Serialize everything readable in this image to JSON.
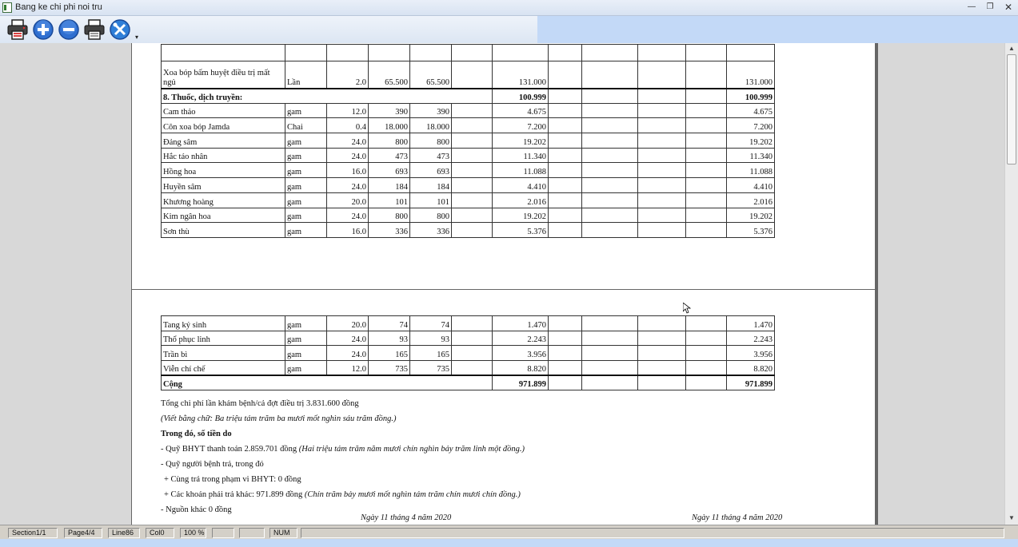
{
  "window": {
    "title": "Bang ke chi phi noi tru"
  },
  "toolbar": {
    "buttons": [
      {
        "name": "print-preview",
        "icon": "print-preview-icon"
      },
      {
        "name": "zoom-in",
        "icon": "plus-circle-icon"
      },
      {
        "name": "zoom-out",
        "icon": "minus-circle-icon"
      },
      {
        "name": "print",
        "icon": "printer-icon"
      },
      {
        "name": "tools",
        "icon": "tools-icon"
      }
    ]
  },
  "page1": {
    "rows": [
      {
        "name": "Xoa bóp bấm huyệt điều trị mất ngủ",
        "unit": "Lần",
        "qty": "2.0",
        "price1": "65.500",
        "price2": "65.500",
        "c6": "",
        "amount": "131.000",
        "c8": "",
        "c9": "",
        "c10": "",
        "c11": "",
        "total": "131.000"
      },
      {
        "name": "8. Thuốc, dịch truyền:",
        "amount": "100.999",
        "total": "100.999"
      },
      {
        "name": "Cam thảo",
        "unit": "gam",
        "qty": "12.0",
        "price1": "390",
        "price2": "390",
        "c6": "",
        "amount": "4.675",
        "c8": "",
        "c9": "",
        "c10": "",
        "c11": "",
        "total": "4.675"
      },
      {
        "name": "Côn xoa bóp Jamda",
        "unit": "Chai",
        "qty": "0.4",
        "price1": "18.000",
        "price2": "18.000",
        "c6": "",
        "amount": "7.200",
        "c8": "",
        "c9": "",
        "c10": "",
        "c11": "",
        "total": "7.200"
      },
      {
        "name": "Đảng sâm",
        "unit": "gam",
        "qty": "24.0",
        "price1": "800",
        "price2": "800",
        "c6": "",
        "amount": "19.202",
        "c8": "",
        "c9": "",
        "c10": "",
        "c11": "",
        "total": "19.202"
      },
      {
        "name": "Hắc táo nhân",
        "unit": "gam",
        "qty": "24.0",
        "price1": "473",
        "price2": "473",
        "c6": "",
        "amount": "11.340",
        "c8": "",
        "c9": "",
        "c10": "",
        "c11": "",
        "total": "11.340"
      },
      {
        "name": "Hồng hoa",
        "unit": "gam",
        "qty": "16.0",
        "price1": "693",
        "price2": "693",
        "c6": "",
        "amount": "11.088",
        "c8": "",
        "c9": "",
        "c10": "",
        "c11": "",
        "total": "11.088"
      },
      {
        "name": "Huyền sâm",
        "unit": "gam",
        "qty": "24.0",
        "price1": "184",
        "price2": "184",
        "c6": "",
        "amount": "4.410",
        "c8": "",
        "c9": "",
        "c10": "",
        "c11": "",
        "total": "4.410"
      },
      {
        "name": "Khương hoàng",
        "unit": "gam",
        "qty": "20.0",
        "price1": "101",
        "price2": "101",
        "c6": "",
        "amount": "2.016",
        "c8": "",
        "c9": "",
        "c10": "",
        "c11": "",
        "total": "2.016"
      },
      {
        "name": "Kim ngân hoa",
        "unit": "gam",
        "qty": "24.0",
        "price1": "800",
        "price2": "800",
        "c6": "",
        "amount": "19.202",
        "c8": "",
        "c9": "",
        "c10": "",
        "c11": "",
        "total": "19.202"
      },
      {
        "name": "Sơn thù",
        "unit": "gam",
        "qty": "16.0",
        "price1": "336",
        "price2": "336",
        "c6": "",
        "amount": "5.376",
        "c8": "",
        "c9": "",
        "c10": "",
        "c11": "",
        "total": "5.376"
      }
    ]
  },
  "page2": {
    "rows": [
      {
        "name": "Tang ký sinh",
        "unit": "gam",
        "qty": "20.0",
        "price1": "74",
        "price2": "74",
        "c6": "",
        "amount": "1.470",
        "c8": "",
        "c9": "",
        "c10": "",
        "c11": "",
        "total": "1.470"
      },
      {
        "name": "Thổ phục linh",
        "unit": "gam",
        "qty": "24.0",
        "price1": "93",
        "price2": "93",
        "c6": "",
        "amount": "2.243",
        "c8": "",
        "c9": "",
        "c10": "",
        "c11": "",
        "total": "2.243"
      },
      {
        "name": "Trần bì",
        "unit": "gam",
        "qty": "24.0",
        "price1": "165",
        "price2": "165",
        "c6": "",
        "amount": "3.956",
        "c8": "",
        "c9": "",
        "c10": "",
        "c11": "",
        "total": "3.956"
      },
      {
        "name": "Viễn chí chế",
        "unit": "gam",
        "qty": "12.0",
        "price1": "735",
        "price2": "735",
        "c6": "",
        "amount": "8.820",
        "c8": "",
        "c9": "",
        "c10": "",
        "c11": "",
        "total": "8.820"
      }
    ],
    "total_row": {
      "label": "Cộng",
      "amount": "971.899",
      "total": "971.899"
    },
    "notes": {
      "line1": "Tổng chi phí lần khám bệnh/cả đợt điều trị 3.831.600 đồng",
      "line2": "(Viết bằng chữ: Ba triệu tám trăm ba mươi mốt nghìn sáu trăm đồng.)",
      "line3": "Trong đó, số tiền do",
      "line4_a": "- Quỹ BHYT thanh toán 2.859.701 đồng ",
      "line4_b": "(Hai triệu tám trăm năm mươi chín nghìn bảy trăm linh một đồng.)",
      "line5": "- Quỹ người bệnh trả, trong đó",
      "line6": "+ Cùng trả trong phạm vi BHYT: 0 đồng",
      "line7_a": "+ Các khoản phải trả khác: 971.899 đồng ",
      "line7_b": "(Chín trăm bảy mươi mốt nghìn tám trăm chín mươi chín đồng.)",
      "line8": "- Nguồn khác 0 đồng"
    },
    "date_left": "Ngày 11 tháng 4 năm 2020",
    "date_right": "Ngày 11 tháng 4 năm 2020"
  },
  "status": {
    "section": "Section1/1",
    "page": "Page4/4",
    "line": "Line86",
    "col": "Col0",
    "zoom": "100 %",
    "blank1": "",
    "blank2": "",
    "num": "NUM"
  }
}
